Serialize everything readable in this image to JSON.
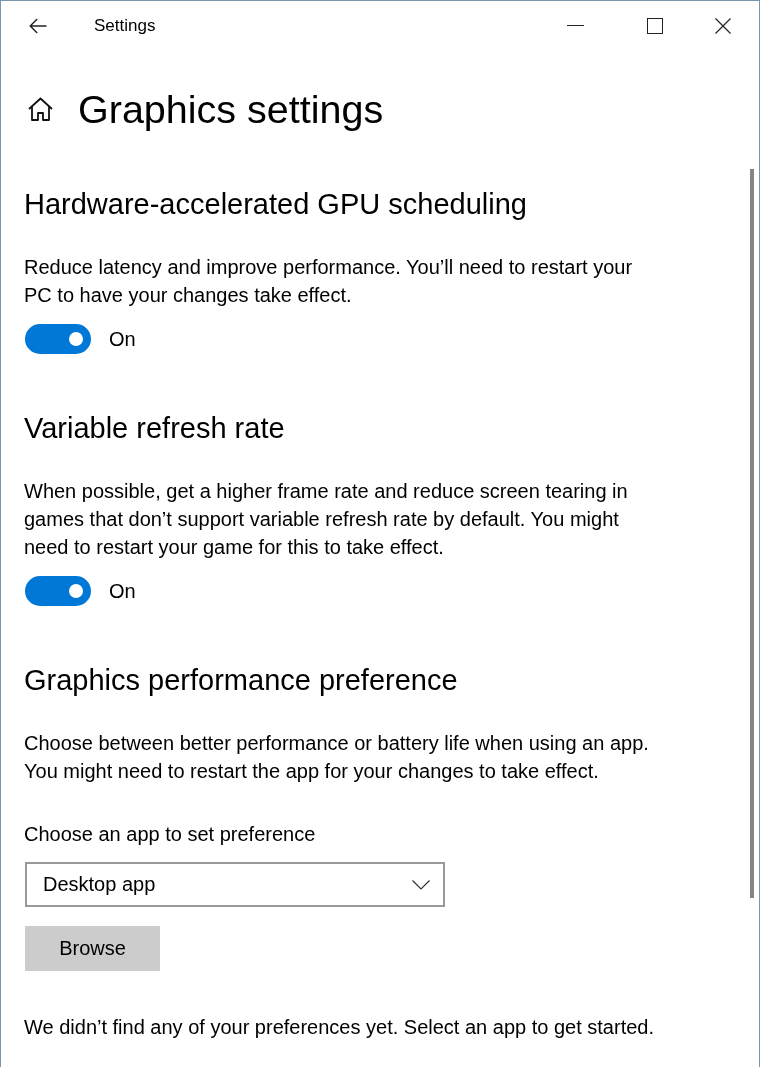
{
  "window": {
    "title": "Settings"
  },
  "page": {
    "title": "Graphics settings"
  },
  "sections": [
    {
      "kind": "toggle",
      "heading": "Hardware-accelerated GPU scheduling",
      "description": "Reduce latency and improve performance. You’ll need to restart your PC to have your changes take effect.",
      "toggle": {
        "on": true,
        "label": "On"
      }
    },
    {
      "kind": "toggle",
      "heading": "Variable refresh rate",
      "description": "When possible, get a higher frame rate and reduce screen tearing in games that don’t support variable refresh rate by default. You might need to restart your game for this to take effect.",
      "toggle": {
        "on": true,
        "label": "On"
      }
    },
    {
      "kind": "preference",
      "heading": "Graphics performance preference",
      "description": "Choose between better performance or battery life when using an app. You might need to restart the app for your changes to take effect.",
      "field_label": "Choose an app to set preference",
      "dropdown": {
        "value": "Desktop app"
      },
      "button": "Browse",
      "note": "We didn’t find any of your preferences yet. Select an app to get started."
    }
  ]
}
